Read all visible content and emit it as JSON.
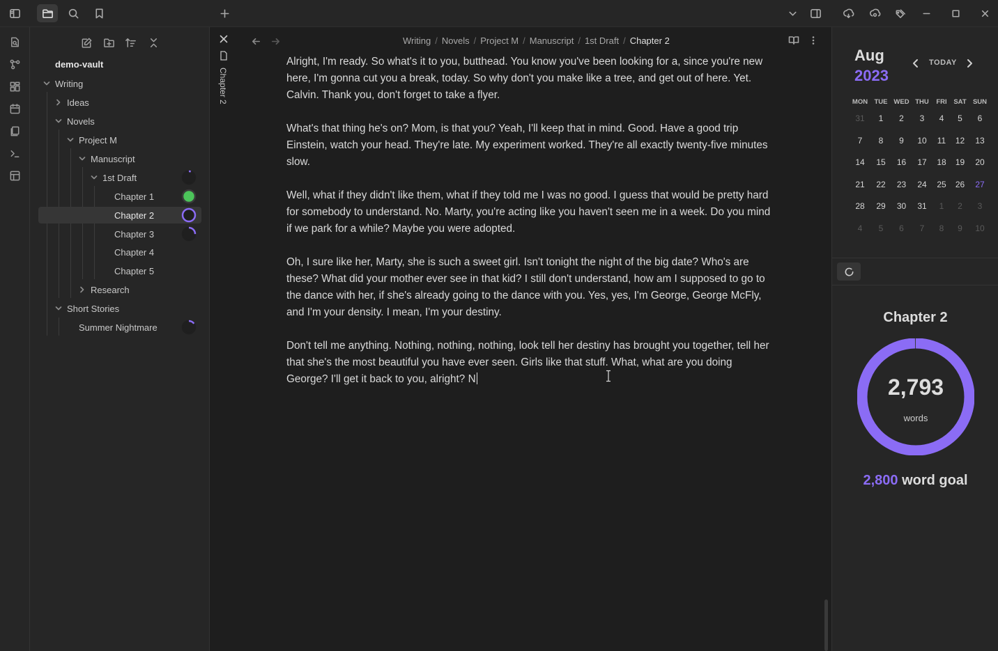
{
  "accent_color": "#8b6cf5",
  "titlebar": {
    "left_icons": [
      "sidebar-toggle-icon",
      "folder-icon",
      "search-icon",
      "bookmark-icon",
      "new-tab-icon"
    ],
    "right_icons": [
      "chevron-down-icon",
      "split-panel-icon",
      "sync-icon",
      "publish-icon",
      "tags-icon",
      "minimize-icon",
      "maximize-icon",
      "close-icon"
    ]
  },
  "ribbon": {
    "icons": [
      "open-quick-switcher-icon",
      "graph-view-icon",
      "canvas-icon",
      "daily-note-icon",
      "templates-icon",
      "command-palette-icon",
      "workspace-icon"
    ]
  },
  "explorer": {
    "toolbar_icons": [
      "new-note-icon",
      "new-folder-icon",
      "sort-icon",
      "collapse-all-icon"
    ],
    "vault_name": "demo-vault",
    "items": {
      "writing": "Writing",
      "ideas": "Ideas",
      "novels": "Novels",
      "project_m": "Project M",
      "manuscript": "Manuscript",
      "first_draft": "1st Draft",
      "chapter1": "Chapter 1",
      "chapter2": "Chapter 2",
      "chapter3": "Chapter 3",
      "chapter4": "Chapter 4",
      "chapter5": "Chapter 5",
      "research": "Research",
      "short_stories": "Short Stories",
      "summer_nightmare": "Summer Nightmare"
    },
    "progress": {
      "first_draft": 0.05,
      "chapter1": 1.0,
      "chapter2": 0.997,
      "chapter3": 0.25,
      "summer_nightmare": 0.15
    },
    "progress_complete_color": "#4cc45a"
  },
  "stacked_tab": {
    "label": "Chapter 2"
  },
  "editor": {
    "breadcrumb": [
      "Writing",
      "Novels",
      "Project M",
      "Manuscript",
      "1st Draft"
    ],
    "current": "Chapter 2",
    "paragraphs": [
      "Alright, I'm ready. So what's it to you, butthead. You know you've been looking for a, since you're new here, I'm gonna cut you a break, today. So why don't you make like a tree, and get out of here. Yet. Calvin. Thank you, don't forget to take a flyer.",
      "What's that thing he's on? Mom, is that you? Yeah, I'll keep that in mind. Good. Have a good trip Einstein, watch your head. They're late. My experiment worked. They're all exactly twenty-five minutes slow.",
      "Well, what if they didn't like them, what if they told me I was no good. I guess that would be pretty hard for somebody to understand. No. Marty, you're acting like you haven't seen me in a week. Do you mind if we park for a while? Maybe you were adopted.",
      "Oh, I sure like her, Marty, she is such a sweet girl. Isn't tonight the night of the big date? Who's are these? What did your mother ever see in that kid? I still don't understand, how am I supposed to go to the dance with her, if she's already going to the dance with you. Yes, yes, I'm George, George McFly, and I'm your density. I mean, I'm your destiny.",
      "Don't tell me anything. Nothing, nothing, nothing, look tell her destiny has brought you together, tell her that she's the most beautiful you have ever seen. Girls like that stuff. What, what are you doing George? I'll get it back to you, alright? N"
    ]
  },
  "calendar": {
    "month": "Aug",
    "year": "2023",
    "today_label": "TODAY",
    "weekdays": [
      "MON",
      "TUE",
      "WED",
      "THU",
      "FRI",
      "SAT",
      "SUN"
    ],
    "weeks": [
      [
        "31",
        "1",
        "2",
        "3",
        "4",
        "5",
        "6"
      ],
      [
        "7",
        "8",
        "9",
        "10",
        "11",
        "12",
        "13"
      ],
      [
        "14",
        "15",
        "16",
        "17",
        "18",
        "19",
        "20"
      ],
      [
        "21",
        "22",
        "23",
        "24",
        "25",
        "26",
        "27"
      ],
      [
        "28",
        "29",
        "30",
        "31",
        "1",
        "2",
        "3"
      ],
      [
        "4",
        "5",
        "6",
        "7",
        "8",
        "9",
        "10"
      ]
    ],
    "other_month": [
      [
        0
      ],
      [],
      [],
      [],
      [
        4,
        5,
        6
      ],
      [
        0,
        1,
        2,
        3,
        4,
        5,
        6
      ]
    ],
    "today": [
      3,
      6
    ]
  },
  "word_goal": {
    "title": "Chapter 2",
    "count": "2,793",
    "unit": "words",
    "goal_number": "2,800",
    "goal_label": "word goal",
    "progress": 0.9975
  }
}
